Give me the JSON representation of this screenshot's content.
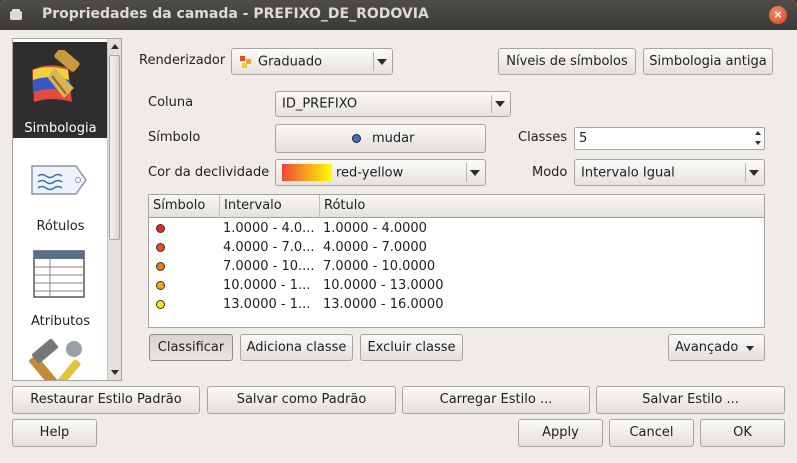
{
  "window": {
    "title": "Propriedades da camada - PREFIXO_DE_RODOVIA",
    "close_symbol": "×"
  },
  "sidebar": {
    "items": [
      {
        "label": "Simbologia",
        "icon": "symbology-brush-icon",
        "selected": true
      },
      {
        "label": "Rótulos",
        "icon": "label-tag-icon",
        "selected": false
      },
      {
        "label": "Atributos",
        "icon": "attributes-table-icon",
        "selected": false
      },
      {
        "label": "",
        "icon": "tools-hammer-wrench-icon",
        "selected": false
      }
    ]
  },
  "renderer": {
    "label": "Renderizador",
    "value": "Graduado",
    "levels_button": "Níveis de símbolos",
    "old_symbology_button": "Simbologia antiga"
  },
  "column": {
    "label": "Coluna",
    "value": "ID_PREFIXO"
  },
  "symbol": {
    "label": "Símbolo",
    "change_button": "mudar"
  },
  "classes": {
    "label": "Classes",
    "value": "5"
  },
  "color_ramp": {
    "label": "Cor da declividade",
    "value": "red-yellow",
    "colors": [
      "#f0463c",
      "#ffff00"
    ]
  },
  "mode": {
    "label": "Modo",
    "value": "Intervalo Igual"
  },
  "table": {
    "headers": [
      "Símbolo",
      "Intervalo",
      "Rótulo"
    ],
    "rows": [
      {
        "color": "#e3271b",
        "interval": "1.0000 - 4.0...",
        "label": "1.0000 - 4.0000"
      },
      {
        "color": "#ea4a15",
        "interval": "4.0000 - 7.0...",
        "label": "4.0000 - 7.0000"
      },
      {
        "color": "#f07a10",
        "interval": "7.0000 - 10....",
        "label": "7.0000 - 10.0000"
      },
      {
        "color": "#f5a80a",
        "interval": "10.0000 - 1...",
        "label": "10.0000 - 13.0000"
      },
      {
        "color": "#fbe70a",
        "interval": "13.0000 - 1...",
        "label": "13.0000 - 16.0000"
      }
    ]
  },
  "actions": {
    "classify": "Classificar",
    "add_class": "Adiciona classe",
    "delete_class": "Excluir classe",
    "advanced": "Avançado"
  },
  "style_buttons": {
    "restore": "Restaurar Estilo Padrão",
    "save_default": "Salvar como Padrão",
    "load": "Carregar Estilo ...",
    "save": "Salvar Estilo ..."
  },
  "dialog_buttons": {
    "help": "Help",
    "apply": "Apply",
    "cancel": "Cancel",
    "ok": "OK"
  }
}
